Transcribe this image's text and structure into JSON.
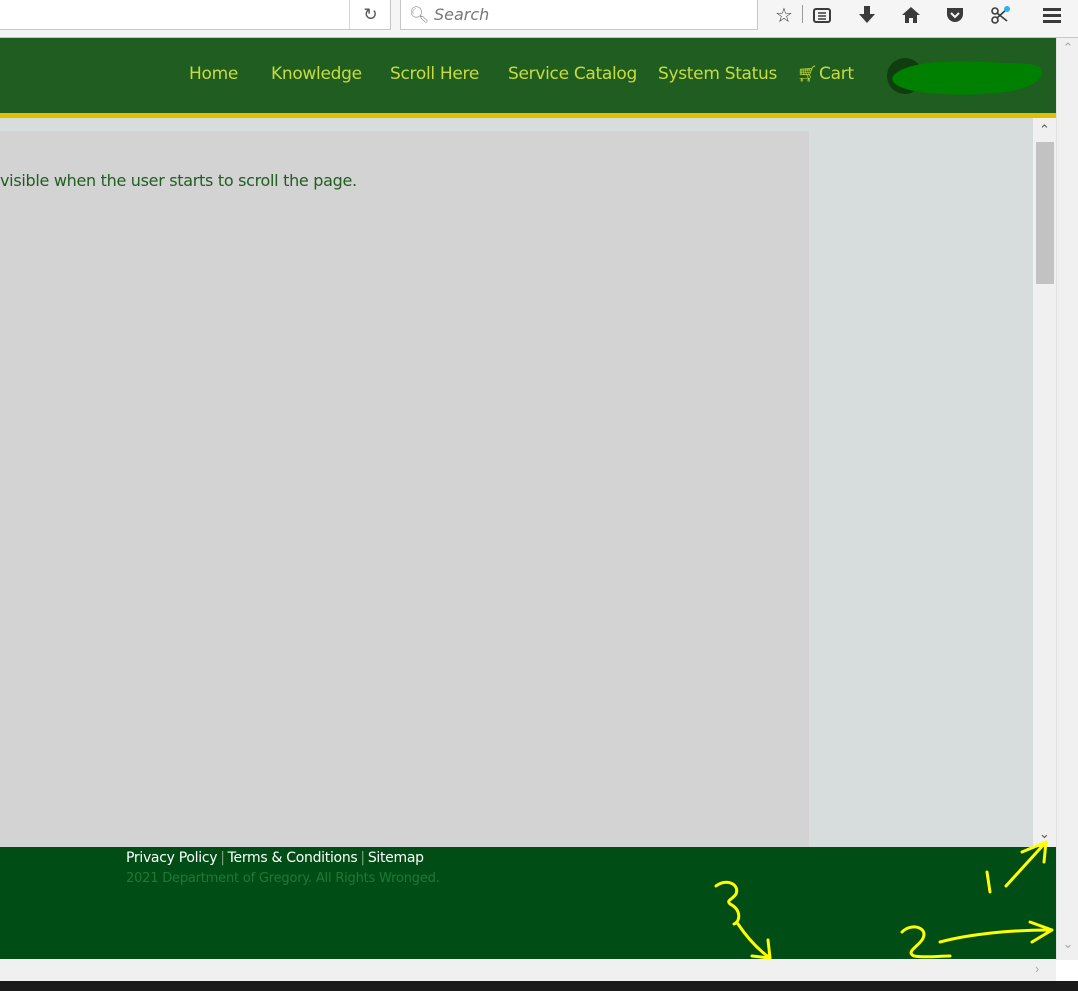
{
  "browser": {
    "search_placeholder": "Search",
    "icons": [
      "reload-icon",
      "bookmark-star-icon",
      "reading-list-icon",
      "download-icon",
      "home-icon",
      "pocket-icon",
      "extension-icon",
      "menu-icon"
    ]
  },
  "nav": {
    "items": [
      "Home",
      "Knowledge",
      "Scroll Here",
      "Service Catalog",
      "System Status"
    ],
    "cart_label": "Cart"
  },
  "main": {
    "text": "visible when the user starts to scroll the page."
  },
  "footer": {
    "links": [
      "Privacy Policy",
      "Terms & Conditions",
      "Sitemap"
    ],
    "copyright": "2021 Department of Gregory. All Rights Wronged."
  },
  "annotations": [
    "1",
    "2",
    "3"
  ],
  "colors": {
    "nav_bg": "#1f5d21",
    "nav_link": "#c8dc3b",
    "gold_rule": "#e2bd00",
    "footer_bg": "#004d16",
    "annotation": "#ffff00"
  }
}
